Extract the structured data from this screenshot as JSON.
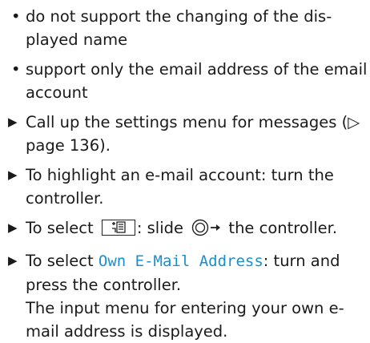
{
  "bullets": [
    "do not support the changing of the dis­played name",
    "support only the email address of the email account"
  ],
  "steps": {
    "s1": {
      "text": "Call up the settings menu for messages (▷ page 136)."
    },
    "s2": {
      "text": "To highlight an e-mail account: turn the controller."
    },
    "s3": {
      "pre": "To select",
      "mid": ": slide",
      "post": "the controller."
    },
    "s4": {
      "pre": "To select",
      "highlight": "Own E-Mail Address",
      "post": ": turn and press the controller.",
      "result": "The input menu for entering your own e-mail address is displayed."
    }
  },
  "glyphs": {
    "bullet": "•",
    "step": "▶"
  },
  "icons": {
    "menu_key": "menu-key-icon",
    "controller_slide": "controller-slide-right-icon"
  },
  "colors": {
    "highlight": "#1a8fd0",
    "text": "#1a1a1a"
  }
}
